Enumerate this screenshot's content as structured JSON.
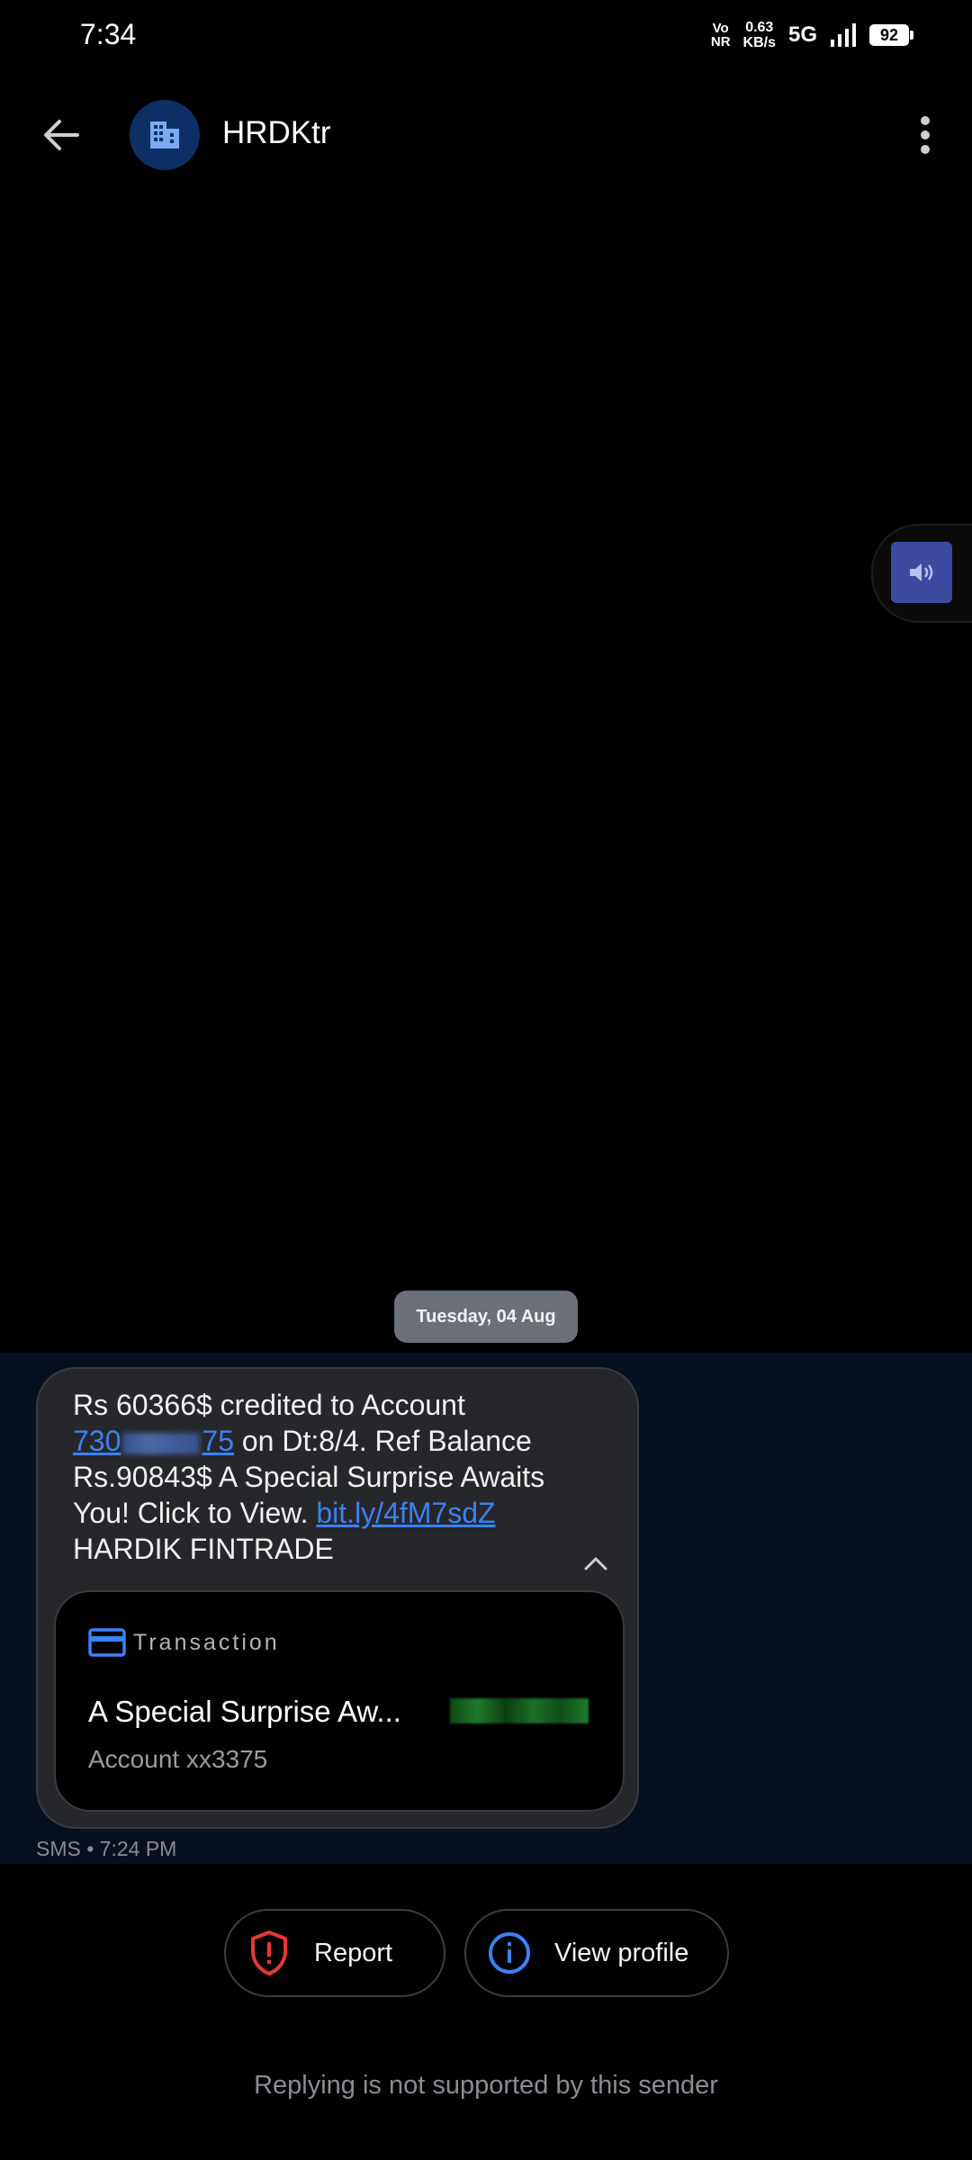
{
  "status_bar": {
    "time": "7:34",
    "volte_top": "Vo",
    "volte_bottom": "NR",
    "speed_value": "0.63",
    "speed_unit": "KB/s",
    "network": "5G",
    "battery": "92"
  },
  "header": {
    "sender": "HRDKtr"
  },
  "date_chip": "Tuesday, 04 Aug",
  "message": {
    "line1": "Rs 60366$ credited to Account",
    "account_prefix": "730",
    "account_suffix": "75",
    "line2_rest": " on Dt:8/4. Ref Balance",
    "line3": "Rs.90843$ A Special Surprise Awaits",
    "line4": "You! Click to View. ",
    "link": "bit.ly/4fM7sdZ",
    "line5": "HARDIK FINTRADE"
  },
  "card": {
    "type_label": "Transaction",
    "title": "A Special Surprise Aw...",
    "subtitle": "Account xx3375"
  },
  "meta": "SMS • 7:24 PM",
  "actions": {
    "report": "Report",
    "view_profile": "View profile"
  },
  "reply_note": "Replying is not supported by this sender",
  "colors": {
    "link": "#3b82f6",
    "report_icon": "#e53935",
    "profile_icon": "#3b82f6",
    "avatar_bg": "#0e2f66"
  }
}
